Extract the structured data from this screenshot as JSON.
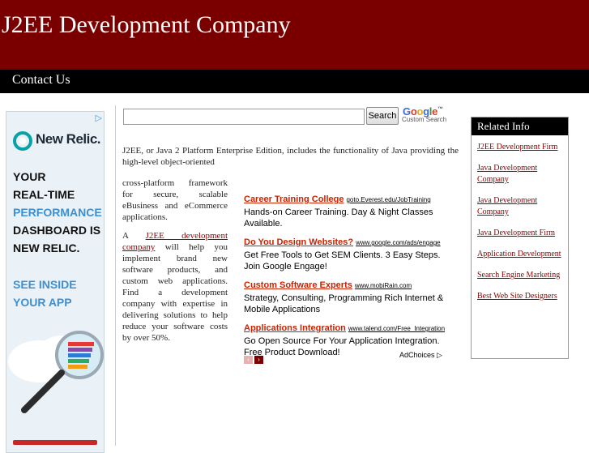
{
  "header": {
    "title": "J2EE Development Company"
  },
  "nav": {
    "contact": "Contact Us"
  },
  "left_ad": {
    "adchoice_glyph": "▷",
    "brand": "New Relic.",
    "lines": [
      "YOUR",
      "REAL-TIME",
      "PERFORMANCE",
      "DASHBOARD IS",
      "NEW RELIC."
    ],
    "cta": [
      "SEE INSIDE",
      "YOUR APP"
    ],
    "highlight_color": "#3d8fd0",
    "icons": [
      "new-relic-logo-icon",
      "magnifier-icon"
    ]
  },
  "search": {
    "value": "",
    "button": "Search",
    "google": [
      "G",
      "o",
      "o",
      "g",
      "l",
      "e"
    ],
    "tm": "™",
    "custom": "Custom Search"
  },
  "content": {
    "intro": "J2EE, or Java 2 Platform Enterprise Edition, includes the functionality of Java providing the high-level object-oriented",
    "para1": "cross-platform framework for secure, scalable eBusiness and eCommerce applications.",
    "para2_pre": "A ",
    "para2_link": "J2EE development company",
    "para2_post": " will help you implement brand new software products, and custom web applications. Find a development company with expertise in delivering solutions to help reduce your software costs by over 50%."
  },
  "ads": [
    {
      "title": "Career Training College",
      "url": "goto.Everest.edu/JobTraining",
      "desc": "Hands-on Career Training. Day & Night Classes Available."
    },
    {
      "title": "Do You Design Websites?",
      "url": "www.google.com/ads/engage",
      "desc": "Get Free Tools to Get SEM Clients. 3 Easy Steps. Join Google Engage!"
    },
    {
      "title": "Custom Software Experts",
      "url": "www.mobiRain.com",
      "desc": "Strategy, Consulting, Programming Rich Internet & Mobile Applications"
    },
    {
      "title": "Applications Integration",
      "url": "www.talend.com/Free_Integration",
      "desc": "Go Open Source For Your Application Integration. Free Product Download!"
    }
  ],
  "ad_controls": {
    "prev": "‹",
    "next": "›",
    "adchoices": "AdChoices ▷"
  },
  "related": {
    "title": "Related Info",
    "items": [
      "J2EE Development Firm",
      "Java Development Company",
      "Java Development Company",
      "Java Development Firm",
      "Application Development",
      "Search Engine Marketing",
      "Best Web Site Designers"
    ]
  },
  "colors": {
    "header": "#7a0000",
    "nav": "#000000",
    "link": "#8b0000",
    "ad_title": "#cc2200"
  }
}
